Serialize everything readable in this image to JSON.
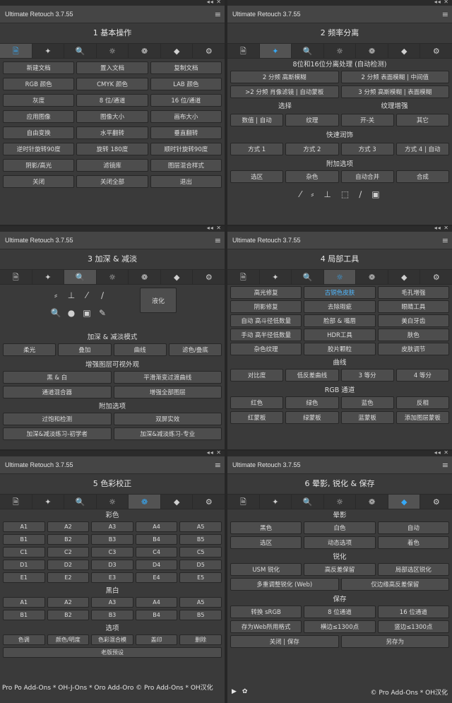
{
  "app_title": "Ultimate Retouch 3.7.55",
  "tab_icons": [
    "document-icon",
    "sparkle-icon",
    "magnifier-icon",
    "sun-icon",
    "color-circles-icon",
    "diamond-icon",
    "gear-icon"
  ],
  "p1": {
    "title": "1 基本操作",
    "rows": [
      [
        "新建文档",
        "置入文档",
        "复制文档"
      ],
      [
        "RGB 颜色",
        "CMYK 颜色",
        "LAB 颜色"
      ],
      [
        "灰度",
        "8 位/通道",
        "16 位/通道"
      ],
      [
        "应用图像",
        "图像大小",
        "画布大小"
      ],
      [
        "自由变换",
        "水平翻转",
        "垂直翻转"
      ],
      [
        "逆时针旋转90度",
        "旋转 180度",
        "顺时针旋转90度"
      ],
      [
        "阴影/高光",
        "滤镜库",
        "图层混合样式"
      ],
      [
        "关闭",
        "关闭全部",
        "退出"
      ]
    ]
  },
  "p2": {
    "title": "2 频率分离",
    "sub": "8位和16位分离处理 (自动检测)",
    "rows_a": [
      [
        "2 分频 高斯模糊",
        "2 分频 表面模糊 | 中间值"
      ],
      [
        ">2 分频 肖像滤镜 | 自动蒙板",
        "3 分频 高斯模糊 | 表面模糊"
      ]
    ],
    "labels": [
      "选择",
      "纹理增强"
    ],
    "row_b": [
      "数值 | 自动",
      "纹理",
      "开-关",
      "其它"
    ],
    "sec1": "快速润饰",
    "row_c": [
      "方式 1",
      "方式 2",
      "方式 3",
      "方式 4 | 自动"
    ],
    "sec2": "附加选项",
    "row_d": [
      "选区",
      "杂色",
      "自动合并",
      "合成"
    ],
    "icons": [
      "brush-icon",
      "brushes-icon",
      "stamp-icon",
      "patch-icon",
      "pen-icon",
      "chip-icon"
    ]
  },
  "p3": {
    "title": "3 加深 & 减淡",
    "big": "液化",
    "dicons": [
      "brushes-icon",
      "stamp-icon",
      "brush-icon",
      "pen-icon",
      "magnifier-icon",
      "blob-icon",
      "chip-icon",
      "pencil-icon"
    ],
    "sec1": "加深 & 减淡模式",
    "row_a": [
      "柔光",
      "叠加",
      "曲线",
      "滤色/叠底"
    ],
    "sec2": "增强图层可视外观",
    "rows_b": [
      [
        "黑 & 白",
        "平滑渐变过渡曲线"
      ],
      [
        "通道混合器",
        "增强全部图层"
      ]
    ],
    "sec3": "附加选项",
    "rows_c": [
      [
        "过饱和检测",
        "双屏实效"
      ],
      [
        "加深&减淡练习-初学者",
        "加深&减淡练习-专业"
      ]
    ]
  },
  "p4": {
    "title": "4 局部工具",
    "rows_a": [
      [
        "高光修复",
        "古铜色皮肤",
        "毛孔增强"
      ],
      [
        "阴影修复",
        "去除瑕疵",
        "眼睛工具"
      ],
      [
        "自动 高斗径低数量",
        "脸部 & 嘴唇",
        "美白牙齿"
      ],
      [
        "手动 高半径低数量",
        "HDR工具",
        "肤色"
      ],
      [
        "杂色纹理",
        "胶片颗粒",
        "皮肤调节"
      ]
    ],
    "sec1": "曲线",
    "row_b": [
      "对比度",
      "低反差曲线",
      "3 等分",
      "4 等分"
    ],
    "sec2": "RGB 通道",
    "rows_c": [
      [
        "红色",
        "绿色",
        "蓝色",
        "反相"
      ],
      [
        "红蒙板",
        "绿蒙板",
        "蓝蒙板",
        "添加图层蒙板"
      ]
    ]
  },
  "p5": {
    "title": "5 色彩校正",
    "sec1": "彩色",
    "color_rows": [
      [
        "A1",
        "A2",
        "A3",
        "A4",
        "A5"
      ],
      [
        "B1",
        "B2",
        "B3",
        "B4",
        "B5"
      ],
      [
        "C1",
        "C2",
        "C3",
        "C4",
        "C5"
      ],
      [
        "D1",
        "D2",
        "D3",
        "D4",
        "D5"
      ],
      [
        "E1",
        "E2",
        "E3",
        "E4",
        "E5"
      ]
    ],
    "sec2": "黑白",
    "bw_rows": [
      [
        "A1",
        "A2",
        "A3",
        "A4",
        "A5"
      ],
      [
        "B1",
        "B2",
        "B3",
        "B4",
        "B5"
      ]
    ],
    "sec3": "选项",
    "row_o": [
      "色调",
      "颜色/明度",
      "色彩混合模",
      "盖印",
      "删除"
    ],
    "row_p": [
      "老版预设"
    ]
  },
  "p6": {
    "title": "6 晕影, 锐化 & 保存",
    "sec1": "晕影",
    "rows_a": [
      [
        "黑色",
        "白色",
        "自动"
      ],
      [
        "选区",
        "动态选项",
        "着色"
      ]
    ],
    "sec2": "锐化",
    "row_b": [
      "USM 锐化",
      "高反差保留",
      "局部选区锐化"
    ],
    "row_c": [
      "多重调整锐化 (Web)",
      "仅边缘高反差保留"
    ],
    "sec3": "保存",
    "row_d": [
      "转换 sRGB",
      "8 位通道",
      "16 位通道"
    ],
    "row_e": [
      "存为Web所用格式",
      "横边≤1300点",
      "竖边≤1300点"
    ],
    "row_f": [
      "关闭 | 保存",
      "另存为"
    ]
  },
  "footer_left": "Pro Po Add-Ons * OH-J-Ons * Oro Add-Oro © Pro Add-Ons * OH汉化",
  "footer_right": "© Pro Add-Ons * OH汉化",
  "accent": "#36a9f6"
}
